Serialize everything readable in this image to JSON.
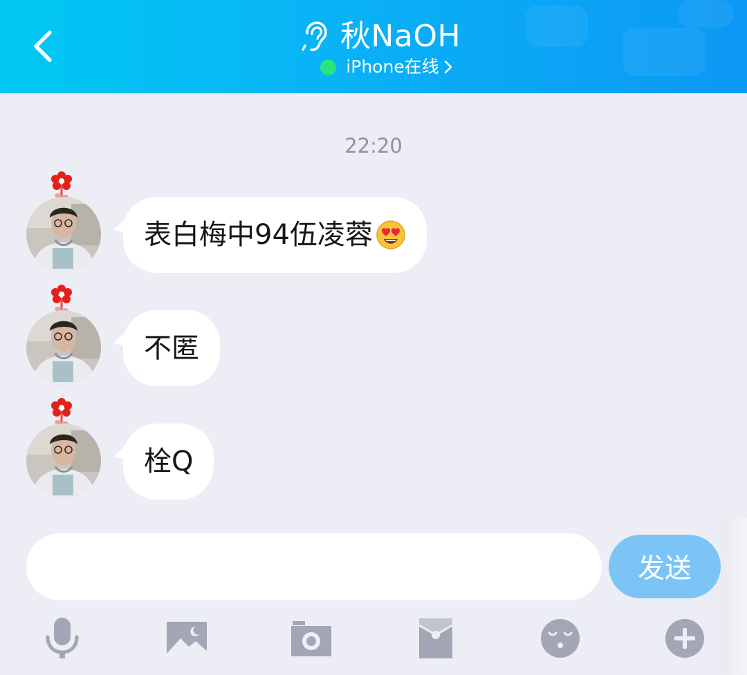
{
  "header": {
    "contact_name": "秋NaOH",
    "status": "iPhone在线",
    "status_color": "#27e57c",
    "gradient": [
      "#00c9f3",
      "#0c98f5"
    ]
  },
  "conversation": {
    "timestamp": "22:20",
    "messages": [
      {
        "text": "表白梅中94伍凌蓉",
        "emoji": "heart-eyes-emoji-icon"
      },
      {
        "text": "不匿"
      },
      {
        "text": "栓Q"
      }
    ]
  },
  "composer": {
    "input_value": "",
    "send_label": "发送",
    "send_color": "#7cc4f5"
  },
  "toolbar": {
    "icons": [
      "microphone-icon",
      "image-icon",
      "camera-icon",
      "red-packet-icon",
      "emoticon-icon",
      "plus-icon"
    ]
  }
}
